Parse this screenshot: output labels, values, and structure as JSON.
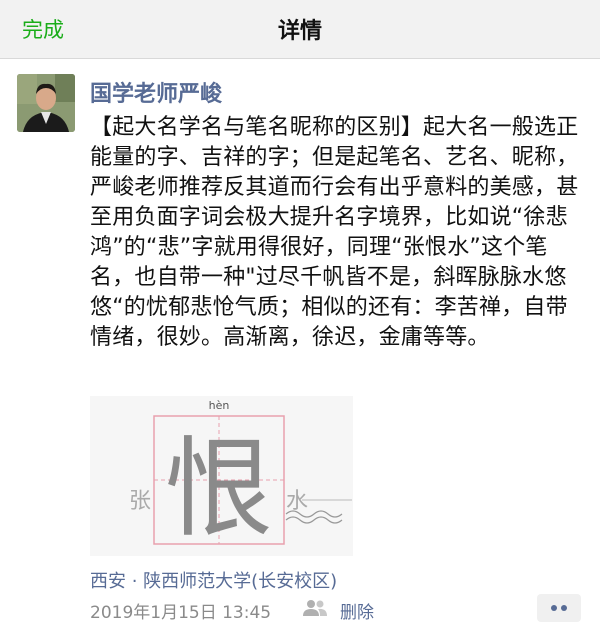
{
  "nav": {
    "done_label": "完成",
    "title": "详情"
  },
  "post": {
    "author": "国学老师严峻",
    "text": "【起大名学名与笔名昵称的区别】起大名一般选正能量的字、吉祥的字；但是起笔名、艺名、昵称，严峻老师推荐反其道而行会有出乎意料的美感，甚至用负面字词会极大提升名字境界，比如说“徐悲鸿”的“悲”字就用得很好，同理“张恨水”这个笔名，也自带一种\"过尽千帆皆不是，斜晖脉脉水悠悠“的忧郁悲怆气质；相似的还有：李苦禅，自带情绪，很妙。高渐离，徐迟，金庸等等。",
    "image": {
      "pinyin": "hèn",
      "main_char": "恨",
      "left_char": "张",
      "right_char": "水"
    },
    "location": "西安 · 陕西师范大学(长安校区)",
    "timestamp": "2019年1月15日 13:45",
    "delete_label": "删除"
  },
  "icons": {
    "visibility": "people-icon",
    "more": "more-dots-icon"
  },
  "colors": {
    "accent_green": "#1aad19",
    "link_blue": "#576b95",
    "grid_pink": "#e8a0ae"
  }
}
